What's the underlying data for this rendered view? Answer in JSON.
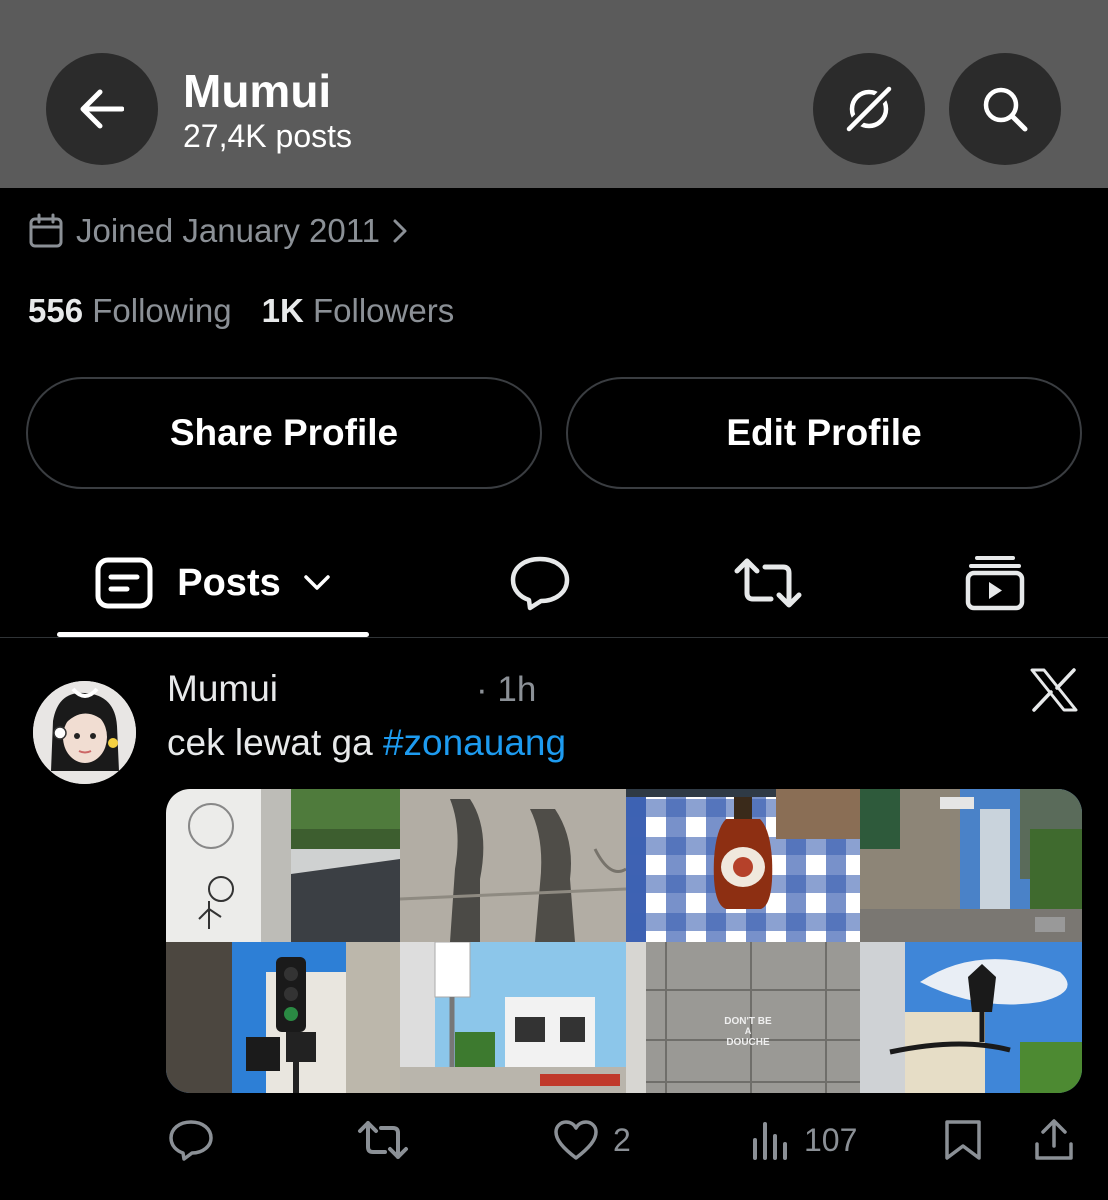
{
  "header": {
    "title": "Mumui",
    "subtitle": "27,4K posts",
    "back_icon": "arrow-left-icon",
    "incognito_icon": "incognito-off-icon",
    "search_icon": "search-icon"
  },
  "profile": {
    "joined": "Joined January 2011",
    "following_count": "556",
    "following_label": "Following",
    "followers_count": "1K",
    "followers_label": "Followers"
  },
  "buttons": {
    "share": "Share Profile",
    "edit": "Edit Profile"
  },
  "tabs": {
    "posts_label": "Posts",
    "items": [
      "posts-icon",
      "replies-icon",
      "reposts-icon",
      "media-icon"
    ]
  },
  "post": {
    "author": "Mumui",
    "time": "· 1h",
    "text": "cek lewat ga ",
    "hashtag": "#zonauang",
    "stencil_text_1": "DON'T BE",
    "stencil_text_2": "A",
    "stencil_text_3": "DOUCHE",
    "likes": "2",
    "views": "107"
  },
  "colors": {
    "header_bg": "#5b5b5b",
    "background": "#000000",
    "muted": "#8b9096",
    "link": "#1d9bf0"
  }
}
